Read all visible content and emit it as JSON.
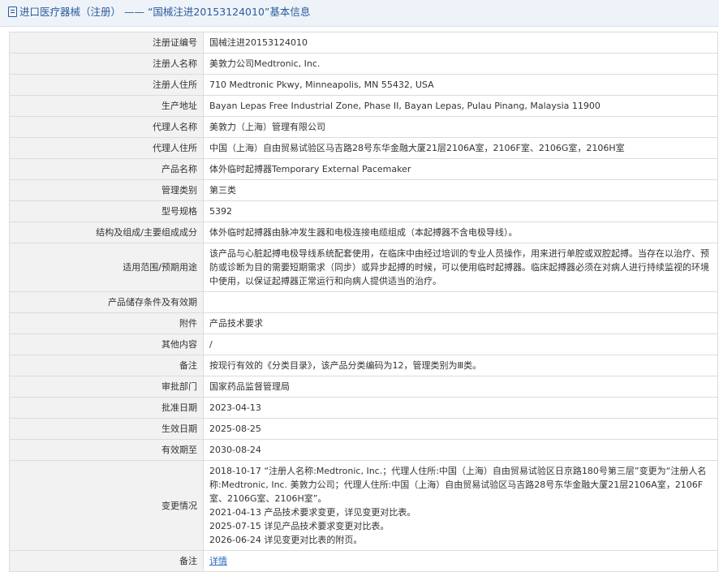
{
  "header": {
    "icon": "document-icon",
    "title": "进口医疗器械（注册） —— “国械注进20153124010”基本信息"
  },
  "rows": [
    {
      "label": "注册证编号",
      "value": "国械注进20153124010"
    },
    {
      "label": "注册人名称",
      "value": "美敦力公司Medtronic, Inc."
    },
    {
      "label": "注册人住所",
      "value": "710 Medtronic Pkwy, Minneapolis, MN 55432, USA"
    },
    {
      "label": "生产地址",
      "value": "Bayan Lepas Free Industrial Zone, Phase II, Bayan Lepas, Pulau Pinang, Malaysia 11900"
    },
    {
      "label": "代理人名称",
      "value": "美敦力（上海）管理有限公司"
    },
    {
      "label": "代理人住所",
      "value": "中国（上海）自由贸易试验区马吉路28号东华金融大厦21层2106A室，2106F室、2106G室，2106H室"
    },
    {
      "label": "产品名称",
      "value": "体外临时起搏器Temporary External Pacemaker"
    },
    {
      "label": "管理类别",
      "value": "第三类"
    },
    {
      "label": "型号规格",
      "value": "5392"
    },
    {
      "label": "结构及组成/主要组成成分",
      "value": "体外临时起搏器由脉冲发生器和电极连接电缆组成（本起搏器不含电极导线）。"
    },
    {
      "label": "适用范围/预期用途",
      "value": "该产品与心脏起搏电极导线系统配套使用，在临床中由经过培训的专业人员操作，用来进行单腔或双腔起搏。当存在以治疗、预防或诊断为目的需要短期需求（同步）或异步起搏的时候，可以使用临时起搏器。临床起搏器必须在对病人进行持续监视的环境中使用，以保证起搏器正常运行和向病人提供适当的治疗。"
    },
    {
      "label": "产品储存条件及有效期",
      "value": ""
    },
    {
      "label": "附件",
      "value": "产品技术要求"
    },
    {
      "label": "其他内容",
      "value": "/"
    },
    {
      "label": "备注",
      "value": "按现行有效的《分类目录》，该产品分类编码为12，管理类别为Ⅲ类。"
    },
    {
      "label": "审批部门",
      "value": "国家药品监督管理局"
    },
    {
      "label": "批准日期",
      "value": "2023-04-13"
    },
    {
      "label": "生效日期",
      "value": "2025-08-25"
    },
    {
      "label": "有效期至",
      "value": "2030-08-24"
    }
  ],
  "change_row": {
    "label": "变更情况",
    "lines": [
      "2018-10-17 “注册人名称:Medtronic, Inc.；代理人住所:中国（上海）自由贸易试验区日京路180号第三层”变更为“注册人名称:Medtronic, Inc. 美敦力公司；代理人住所:中国（上海）自由贸易试验区马吉路28号东华金融大厦21层2106A室，2106F室、2106G室、2106H室”。",
      "2021-04-13 产品技术要求变更，详见变更对比表。",
      "2025-07-15 详见产品技术要求变更对比表。",
      "2026-06-24 详见变更对比表的附页。"
    ]
  },
  "note_row": {
    "label": "备注",
    "link": "详情"
  }
}
